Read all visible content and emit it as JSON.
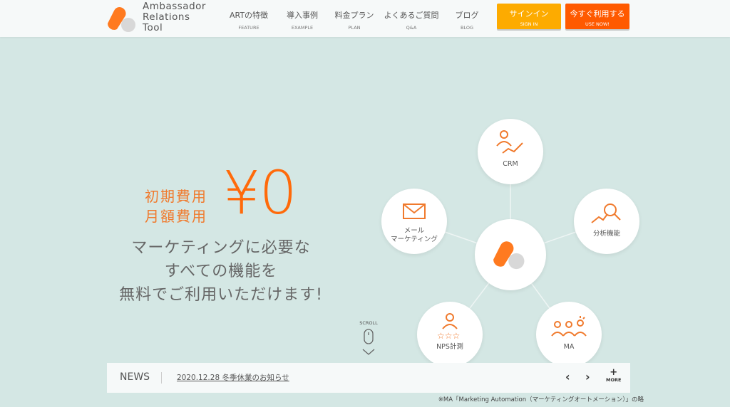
{
  "header": {
    "logo_lines": [
      "Ambassador",
      "Relations",
      "Tool"
    ],
    "nav": [
      {
        "jp": "ARTの特徴",
        "en": "FEATURE"
      },
      {
        "jp": "導入事例",
        "en": "EXAMPLE"
      },
      {
        "jp": "料金プラン",
        "en": "PLAN"
      },
      {
        "jp": "よくあるご質問",
        "en": "Q&A"
      },
      {
        "jp": "ブログ",
        "en": "BLOG"
      }
    ],
    "signin": {
      "jp": "サインイン",
      "en": "SIGN IN",
      "color": "#fdab00"
    },
    "usenow": {
      "jp": "今すぐ利用する",
      "en": "USE NOW!",
      "color": "#ff5a00"
    }
  },
  "hero": {
    "fee_lines": [
      "初期費用",
      "月額費用"
    ],
    "price": "¥0",
    "lines": [
      "マーケティングに必要な",
      "すべての機能を",
      "無料でご利用いただけます!"
    ],
    "accent": "#ff6a0a"
  },
  "features": {
    "crm": "CRM",
    "mail": [
      "メール",
      "マーケティング"
    ],
    "analysis": "分析機能",
    "nps": "NPS計測",
    "ma": "MA"
  },
  "scroll": "SCROLL",
  "news": {
    "title": "NEWS",
    "item": "2020.12.28 冬季休業のお知らせ",
    "more": "MORE"
  },
  "footnote": "※MA「Marketing Automation（マーケティングオートメーション）」の略"
}
